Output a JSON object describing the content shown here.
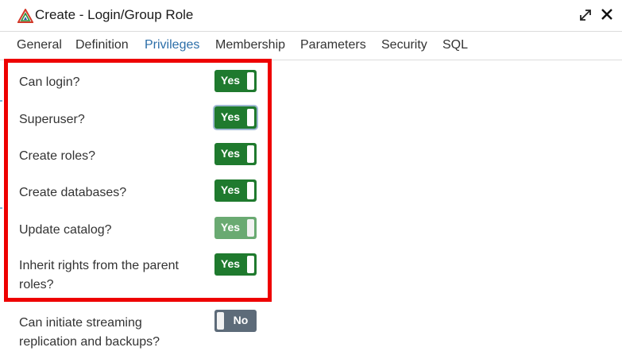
{
  "window": {
    "title": "Create - Login/Group Role",
    "logo_icon": "pgadmin-elephant-logo",
    "expand_icon": "expand-icon",
    "close_icon": "close-icon"
  },
  "tabs": [
    {
      "label": "General",
      "active": false
    },
    {
      "label": "Definition",
      "active": false
    },
    {
      "label": "Privileges",
      "active": true
    },
    {
      "label": "Membership",
      "active": false
    },
    {
      "label": "Parameters",
      "active": false
    },
    {
      "label": "Security",
      "active": false
    },
    {
      "label": "SQL",
      "active": false
    }
  ],
  "privileges": [
    {
      "label": "Can login?",
      "state": "Yes",
      "enabled": true
    },
    {
      "label": "Superuser?",
      "state": "Yes",
      "enabled": true,
      "focused": true
    },
    {
      "label": "Create roles?",
      "state": "Yes",
      "enabled": true
    },
    {
      "label": "Create databases?",
      "state": "Yes",
      "enabled": true
    },
    {
      "label": "Update catalog?",
      "state": "Yes",
      "enabled": false
    },
    {
      "label": "Inherit rights from the parent roles?",
      "state": "Yes",
      "enabled": true
    },
    {
      "label": "Can initiate streaming replication and backups?",
      "state": "No",
      "enabled": true
    }
  ],
  "colors": {
    "toggle_on": "#1f7a2e",
    "toggle_on_disabled": "#6aaa72",
    "toggle_off": "#5d6b79",
    "active_tab": "#2c6ea8",
    "highlight": "#ee0000"
  }
}
